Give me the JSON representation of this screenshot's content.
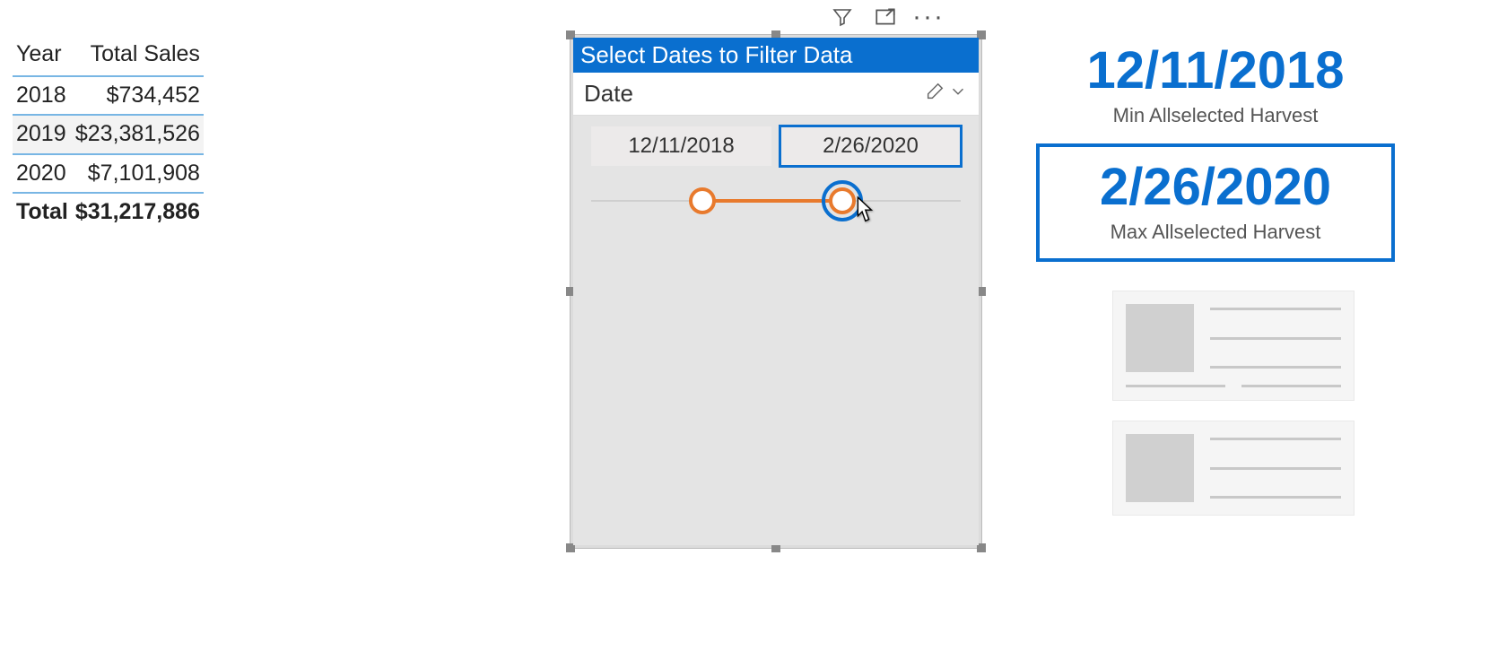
{
  "sales": {
    "headers": {
      "year": "Year",
      "total": "Total Sales"
    },
    "rows": [
      {
        "year": "2018",
        "total": "$734,452"
      },
      {
        "year": "2019",
        "total": "$23,381,526"
      },
      {
        "year": "2020",
        "total": "$7,101,908"
      }
    ],
    "totalRow": {
      "label": "Total",
      "value": "$31,217,886"
    }
  },
  "slicer": {
    "title": "Select Dates to Filter Data",
    "field": "Date",
    "startDate": "12/11/2018",
    "endDate": "2/26/2020",
    "rangePct": {
      "start": 30,
      "end": 68
    }
  },
  "cards": {
    "min": {
      "value": "12/11/2018",
      "label": "Min Allselected Harvest"
    },
    "max": {
      "value": "2/26/2020",
      "label": "Max Allselected Harvest"
    }
  },
  "colors": {
    "accent": "#0a6fcf",
    "sliderFill": "#e87a2d"
  }
}
